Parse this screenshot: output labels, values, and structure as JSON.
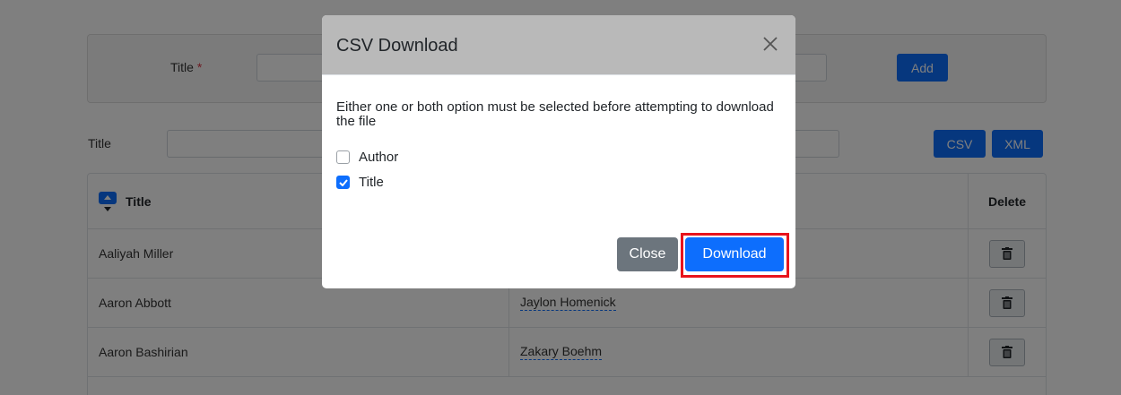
{
  "add_form": {
    "title_label": "Title",
    "required_mark": "*",
    "add_label": "Add"
  },
  "filter": {
    "title_label": "Title",
    "csv_label": "CSV",
    "xml_label": "XML"
  },
  "table": {
    "headers": {
      "title": "Title",
      "delete": "Delete"
    },
    "rows": [
      {
        "title": "Aaliyah Miller",
        "author": ""
      },
      {
        "title": "Aaron Abbott",
        "author": "Jaylon Homenick"
      },
      {
        "title": "Aaron Bashirian",
        "author": "Zakary Boehm"
      }
    ]
  },
  "modal": {
    "title": "CSV Download",
    "message": "Either one or both option must be selected before attempting to download the file",
    "options": [
      {
        "label": "Author",
        "checked": false
      },
      {
        "label": "Title",
        "checked": true
      }
    ],
    "close_label": "Close",
    "download_label": "Download"
  },
  "colors": {
    "primary": "#0d6efd",
    "secondary": "#6c757d",
    "highlight": "#e8141d",
    "modal_header": "#b9b9b9"
  }
}
